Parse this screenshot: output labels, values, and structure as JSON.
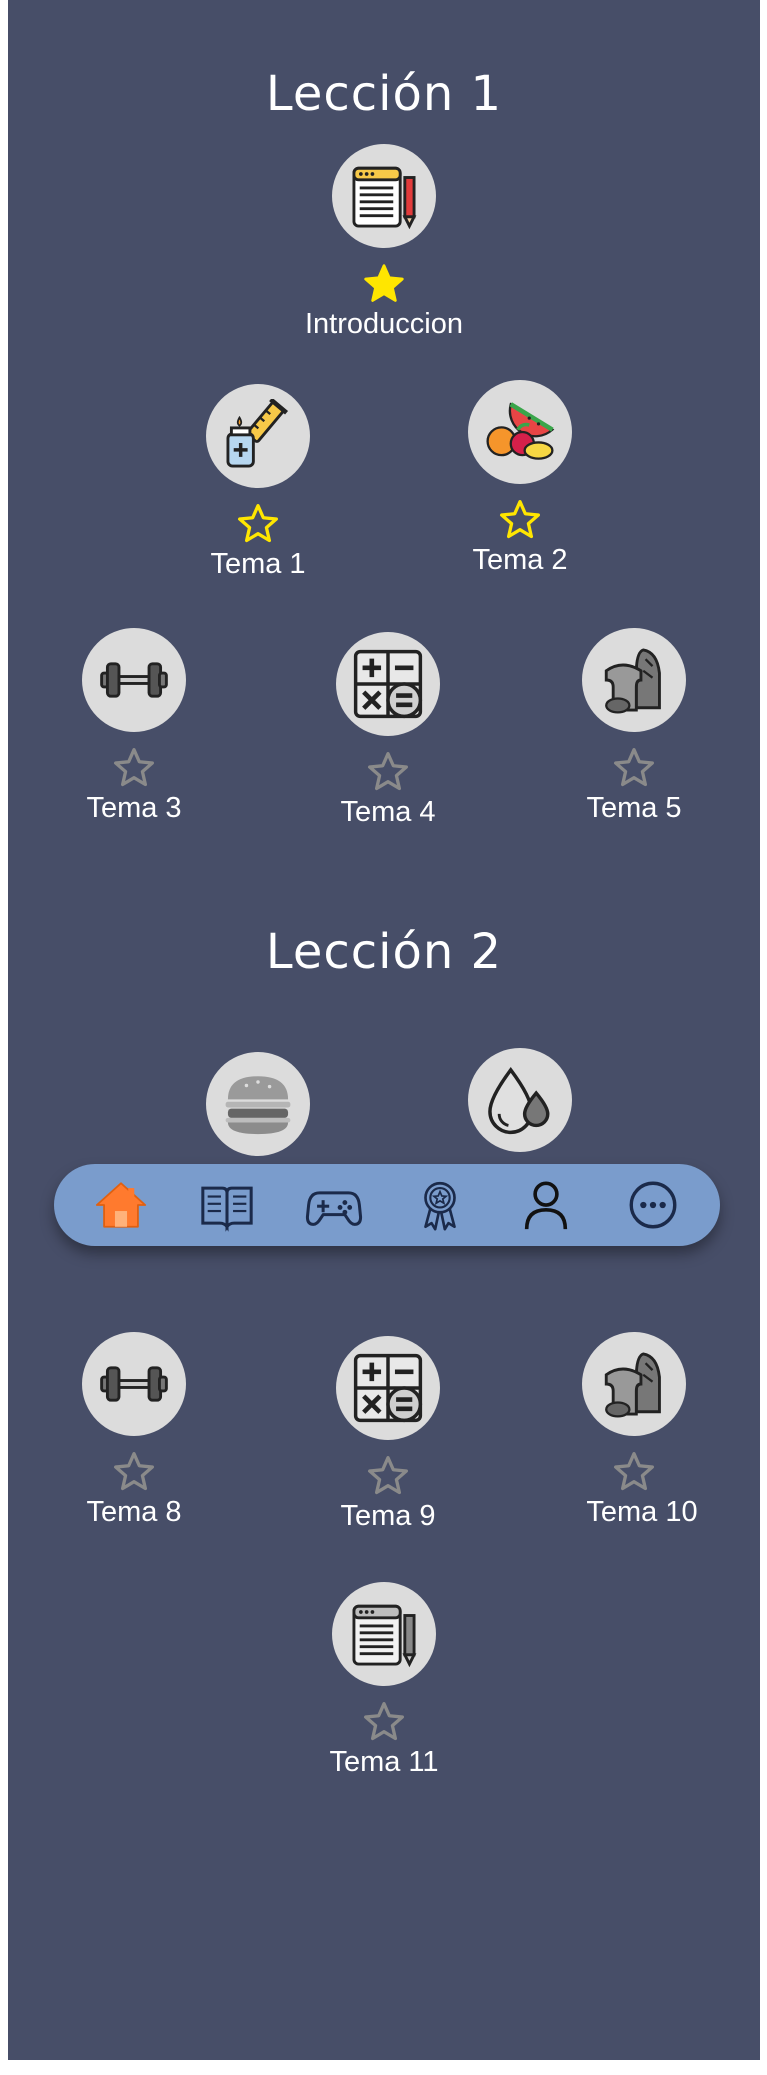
{
  "lessons": [
    {
      "title": "Lección 1"
    },
    {
      "title": "Lección 2"
    }
  ],
  "nodes": {
    "intro": {
      "label": "Introduccion",
      "icon": "notepad-pencil-icon",
      "completed": true
    },
    "t1": {
      "label": "Tema 1",
      "icon": "syringe-vial-icon",
      "completed": false,
      "unlocked": true
    },
    "t2": {
      "label": "Tema 2",
      "icon": "fruits-icon",
      "completed": false,
      "unlocked": true
    },
    "t3": {
      "label": "Tema 3",
      "icon": "dumbbell-icon",
      "unlocked": false
    },
    "t4": {
      "label": "Tema 4",
      "icon": "calculator-icon",
      "unlocked": false
    },
    "t5": {
      "label": "Tema 5",
      "icon": "bread-icon",
      "unlocked": false
    },
    "t6": {
      "icon": "burger-icon",
      "unlocked": false
    },
    "t7": {
      "icon": "water-drops-icon",
      "unlocked": false
    },
    "t8": {
      "label": "Tema 8",
      "icon": "dumbbell-icon",
      "unlocked": false
    },
    "t9": {
      "label": "Tema 9",
      "icon": "calculator-icon",
      "unlocked": false
    },
    "t10": {
      "label": "Tema 10",
      "icon": "bread-icon",
      "unlocked": false
    },
    "t11": {
      "label": "Tema 11",
      "icon": "notepad-pencil-icon",
      "unlocked": false
    }
  },
  "navbar": {
    "items": [
      {
        "icon": "home-icon",
        "active": true
      },
      {
        "icon": "book-icon",
        "active": false
      },
      {
        "icon": "gamepad-icon",
        "active": false
      },
      {
        "icon": "award-badge-icon",
        "active": false
      },
      {
        "icon": "user-icon",
        "active": false
      },
      {
        "icon": "more-icon",
        "active": false
      }
    ]
  },
  "colors": {
    "background": "#474e68",
    "navbar": "#7a9ccc",
    "star_filled": "#ffe600",
    "star_locked": "#8a8a8a",
    "home_active": "#ff7a2e"
  }
}
